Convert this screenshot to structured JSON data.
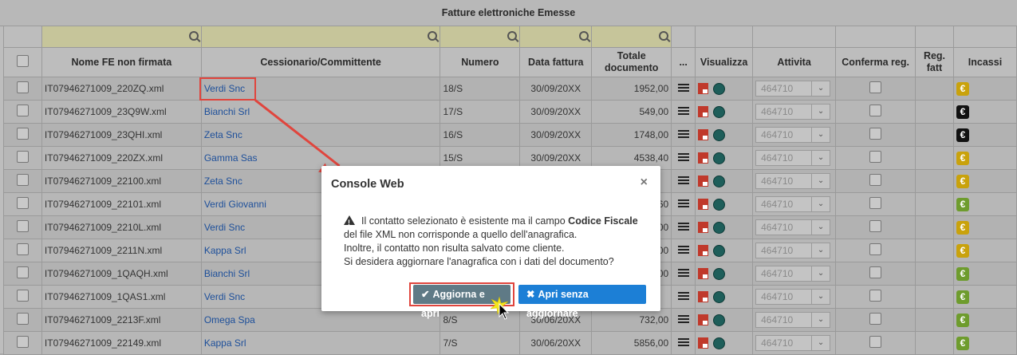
{
  "grid": {
    "title": "Fatture elettroniche Emesse",
    "headers": {
      "file": "Nome FE non firmata",
      "cessionario": "Cessionario/Committente",
      "numero": "Numero",
      "data": "Data fattura",
      "totale": "Totale documento",
      "more": "...",
      "visualizza": "Visualizza",
      "attivita": "Attivita",
      "conferma": "Conferma reg.",
      "reg": "Reg. fatt",
      "incassi": "Incassi"
    },
    "rows": [
      {
        "file": "IT07946271009_220ZQ.xml",
        "cliente": "Verdi Snc",
        "numero": "18/S",
        "data": "30/09/20XX",
        "totale": "1952,00",
        "attivita": "464710",
        "euro": "yellow"
      },
      {
        "file": "IT07946271009_23Q9W.xml",
        "cliente": "Bianchi Srl",
        "numero": "17/S",
        "data": "30/09/20XX",
        "totale": "549,00",
        "attivita": "464710",
        "euro": "black"
      },
      {
        "file": "IT07946271009_23QHI.xml",
        "cliente": "Zeta Snc",
        "numero": "16/S",
        "data": "30/09/20XX",
        "totale": "1748,00",
        "attivita": "464710",
        "euro": "black"
      },
      {
        "file": "IT07946271009_220ZX.xml",
        "cliente": "Gamma Sas",
        "numero": "15/S",
        "data": "30/09/20XX",
        "totale": "4538,40",
        "attivita": "464710",
        "euro": "yellow"
      },
      {
        "file": "IT07946271009_22100.xml",
        "cliente": "Zeta Snc",
        "numero": "",
        "data": "",
        "totale": "",
        "attivita": "464710",
        "euro": "yellow"
      },
      {
        "file": "IT07946271009_22101.xml",
        "cliente": "Verdi Giovanni",
        "numero": "",
        "data": "",
        "totale": "60",
        "attivita": "464710",
        "euro": "green"
      },
      {
        "file": "IT07946271009_2210L.xml",
        "cliente": "Verdi Snc",
        "numero": "",
        "data": "",
        "totale": "00",
        "attivita": "464710",
        "euro": "yellow"
      },
      {
        "file": "IT07946271009_2211N.xml",
        "cliente": "Kappa Srl",
        "numero": "",
        "data": "",
        "totale": "00",
        "attivita": "464710",
        "euro": "yellow"
      },
      {
        "file": "IT07946271009_1QAQH.xml",
        "cliente": "Bianchi Srl",
        "numero": "",
        "data": "",
        "totale": "00",
        "attivita": "464710",
        "euro": "green"
      },
      {
        "file": "IT07946271009_1QAS1.xml",
        "cliente": "Verdi Snc",
        "numero": "",
        "data": "",
        "totale": "",
        "attivita": "464710",
        "euro": "green"
      },
      {
        "file": "IT07946271009_2213F.xml",
        "cliente": "Omega Spa",
        "numero": "8/S",
        "data": "30/06/20XX",
        "totale": "732,00",
        "attivita": "464710",
        "euro": "green"
      },
      {
        "file": "IT07946271009_22149.xml",
        "cliente": "Kappa Srl",
        "numero": "7/S",
        "data": "30/06/20XX",
        "totale": "5856,00",
        "attivita": "464710",
        "euro": "green"
      }
    ]
  },
  "dialog": {
    "title": "Console Web",
    "close": "×",
    "message_prefix": "Il contatto selezionato è esistente ma il campo ",
    "message_bold": "Codice Fiscale",
    "message_suffix": " del file XML non corrisponde a quello dell'anagrafica.",
    "line2": "Inoltre, il contatto non risulta salvato come cliente.",
    "line3": "Si desidera aggiornare l'anagrafica con i dati del documento?",
    "btn_update": "Aggiorna e apri",
    "btn_open": "Apri senza aggiornare"
  },
  "colors": {
    "accent_red": "#e0453d",
    "primary_blue": "#1c7fd6",
    "update_btn": "#5f7a86"
  }
}
